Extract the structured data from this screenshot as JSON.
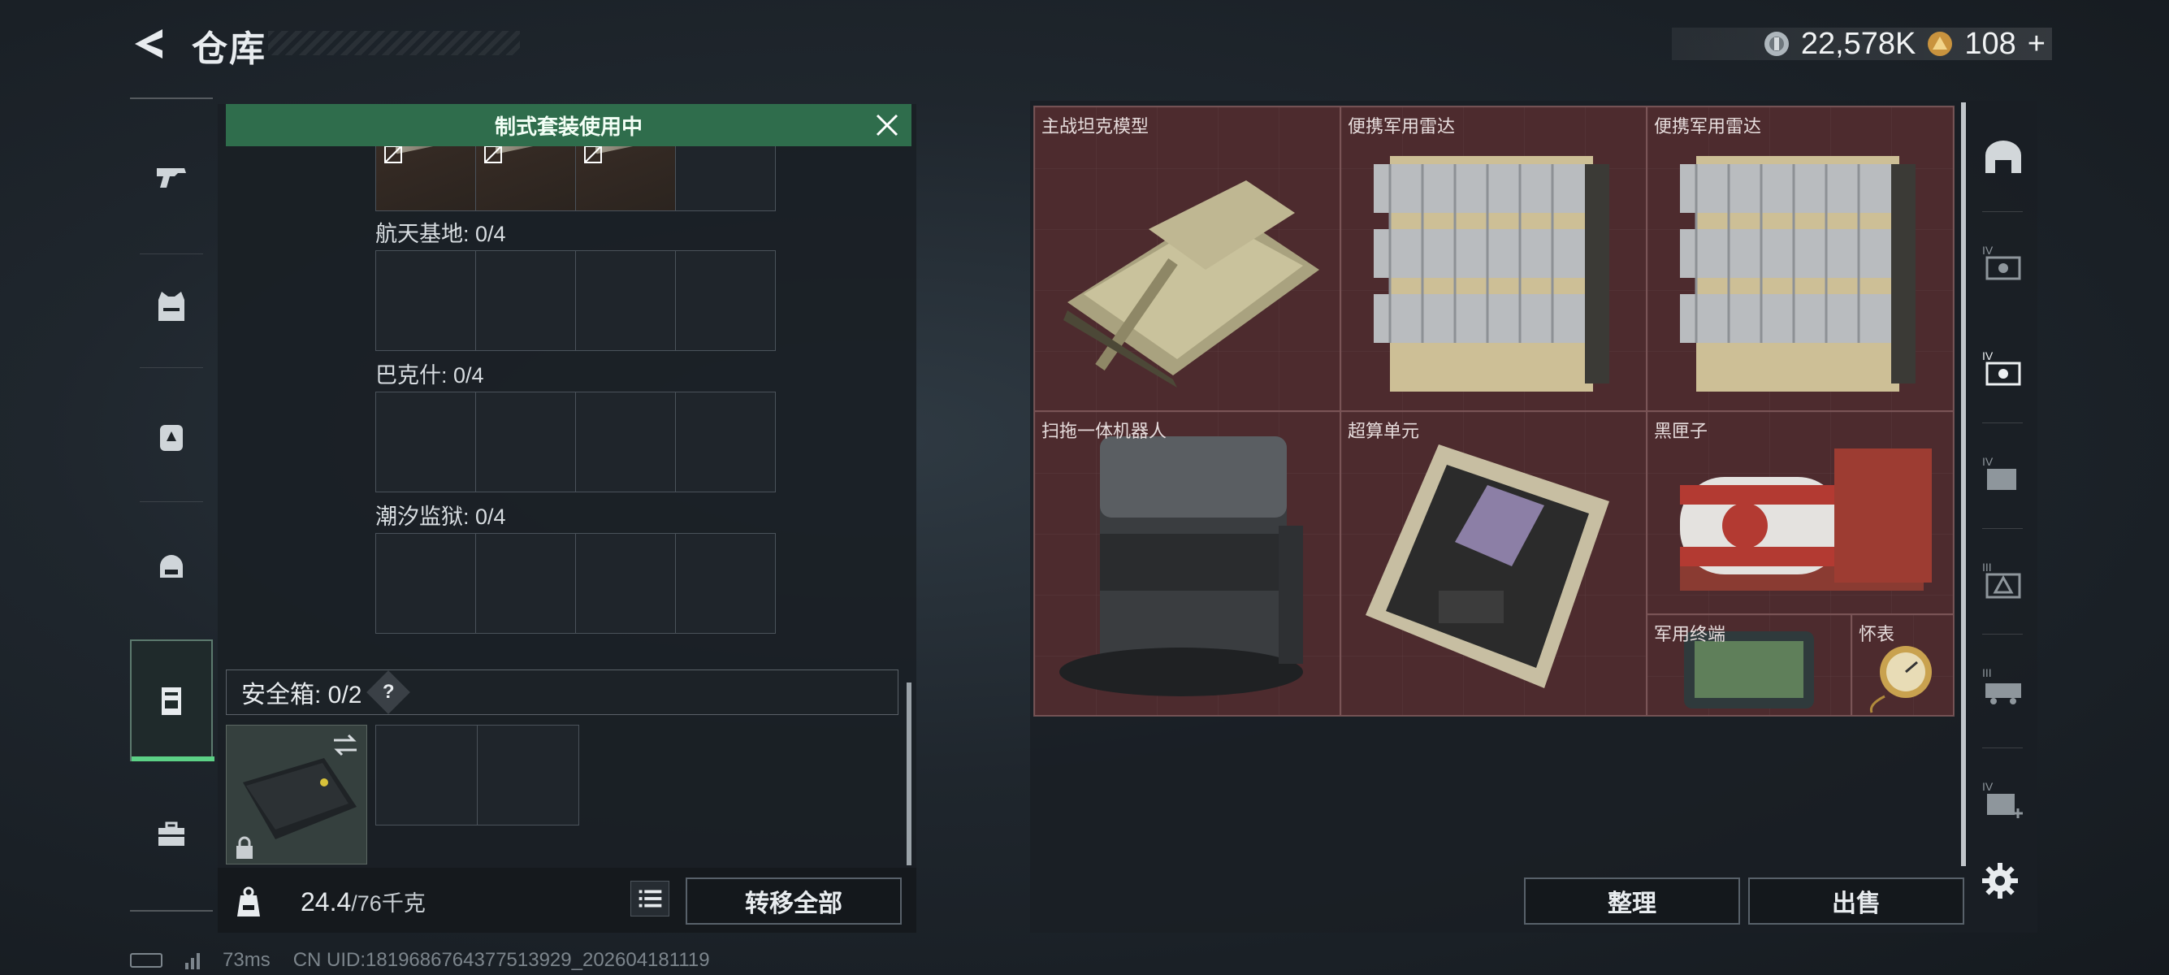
{
  "header": {
    "title": "仓库",
    "currencies": [
      {
        "icon": "silver-coin-icon",
        "value": "22,578K",
        "color": "#b8c0c6"
      },
      {
        "icon": "gold-triangle-coin-icon",
        "value": "108",
        "suffix": "+",
        "color": "#d8a24a"
      }
    ]
  },
  "left_nav": {
    "items": [
      {
        "icon": "pistol-icon"
      },
      {
        "icon": "vest-icon"
      },
      {
        "icon": "backpack-icon"
      },
      {
        "icon": "helmet-bag-icon"
      },
      {
        "icon": "safebox-icon",
        "active": true
      },
      {
        "icon": "toolbox-icon"
      }
    ]
  },
  "left_panel": {
    "banner": "制式套装使用中",
    "map_sections": [
      {
        "label": "航天基地: 0/4"
      },
      {
        "label": "巴克什: 0/4"
      },
      {
        "label": "潮汐监狱: 0/4"
      }
    ],
    "safebox": {
      "label": "安全箱: 0/2",
      "help": "?"
    },
    "weight": {
      "current": "24.4",
      "max": "/76千克"
    },
    "transfer_all": "转移全部"
  },
  "items": [
    {
      "label": "主战坦克模型"
    },
    {
      "label": "便携军用雷达"
    },
    {
      "label": "便携军用雷达"
    },
    {
      "label": "扫拖一体机器人"
    },
    {
      "label": "超算单元"
    },
    {
      "label": "黑匣子"
    },
    {
      "label": "军用终端"
    },
    {
      "label": "怀表"
    }
  ],
  "actions": {
    "tidy": "整理",
    "sell": "出售"
  },
  "right_nav": {
    "items": [
      {
        "icon": "bunker-icon"
      },
      {
        "icon": "tier4-card-slot-icon"
      },
      {
        "icon": "tier4-card-slot-active-icon"
      },
      {
        "icon": "tier4-folder-icon"
      },
      {
        "icon": "tier3-triangle-icon"
      },
      {
        "icon": "tier3-truck-icon"
      },
      {
        "icon": "tier4-medkit-icon"
      }
    ]
  },
  "status": {
    "ping": "73ms",
    "uid": "CN UID:1819686764377513929_202604181119"
  }
}
